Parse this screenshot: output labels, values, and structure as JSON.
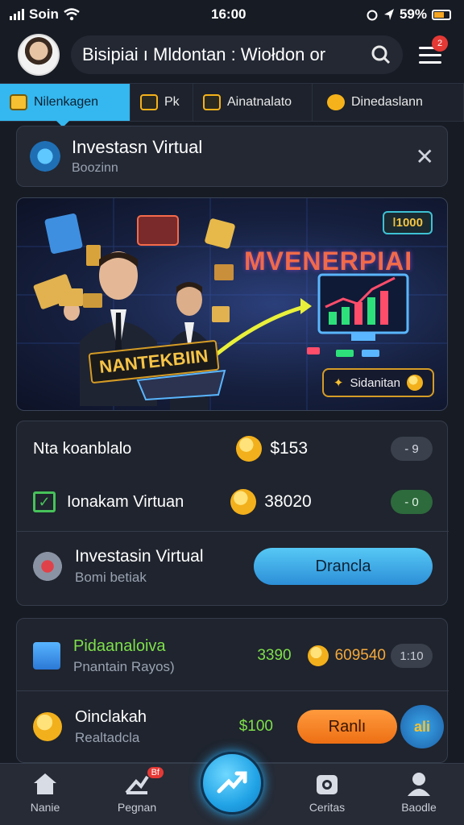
{
  "status": {
    "carrier": "Soin",
    "time": "16:00",
    "battery": "59%"
  },
  "header": {
    "search_text": "Bisipiai ı Mldontan : Wiołdon  or",
    "menu_badge": "2"
  },
  "tabs": [
    {
      "label": "Nilenkagen"
    },
    {
      "label": "Pk"
    },
    {
      "label": "Ainatnalato"
    },
    {
      "label": "Dinedaslann"
    }
  ],
  "info_card": {
    "title": "Investasn Virtual",
    "subtitle": "Boozinn"
  },
  "banner": {
    "pill": "ǀ1000",
    "headline": "MVENERPIAI",
    "gold_text": "NANTEKBIIN",
    "button_label": "Sidanitan"
  },
  "balance": {
    "row1_label": "Nta  koanblalo",
    "row1_amount": "$153",
    "row1_chip": "- 9",
    "row2_label": "Ionakam Virtuan",
    "row2_amount": "38020",
    "row2_chip": "- 0",
    "row3_title": "Investasin Virtual",
    "row3_sub": "Bomi betiak",
    "row3_button": "Drancla"
  },
  "portfolio": {
    "row1_title": "Pidaanaloiva",
    "row1_sub": "Pnantain Rayos)",
    "row1_value": "3390",
    "row1_amount": "609540",
    "row1_chip": "1:10",
    "row2_title": "Oinclakah",
    "row2_sub": "Realtadcla",
    "row2_value": "$100",
    "row2_button": "Ranlı",
    "fab_label": "ali"
  },
  "nav": {
    "items": [
      {
        "label": "Nanie"
      },
      {
        "label": "Pegnan"
      },
      {
        "label": "Ceritas"
      },
      {
        "label": "Baodle"
      }
    ],
    "badge": "Bf"
  }
}
